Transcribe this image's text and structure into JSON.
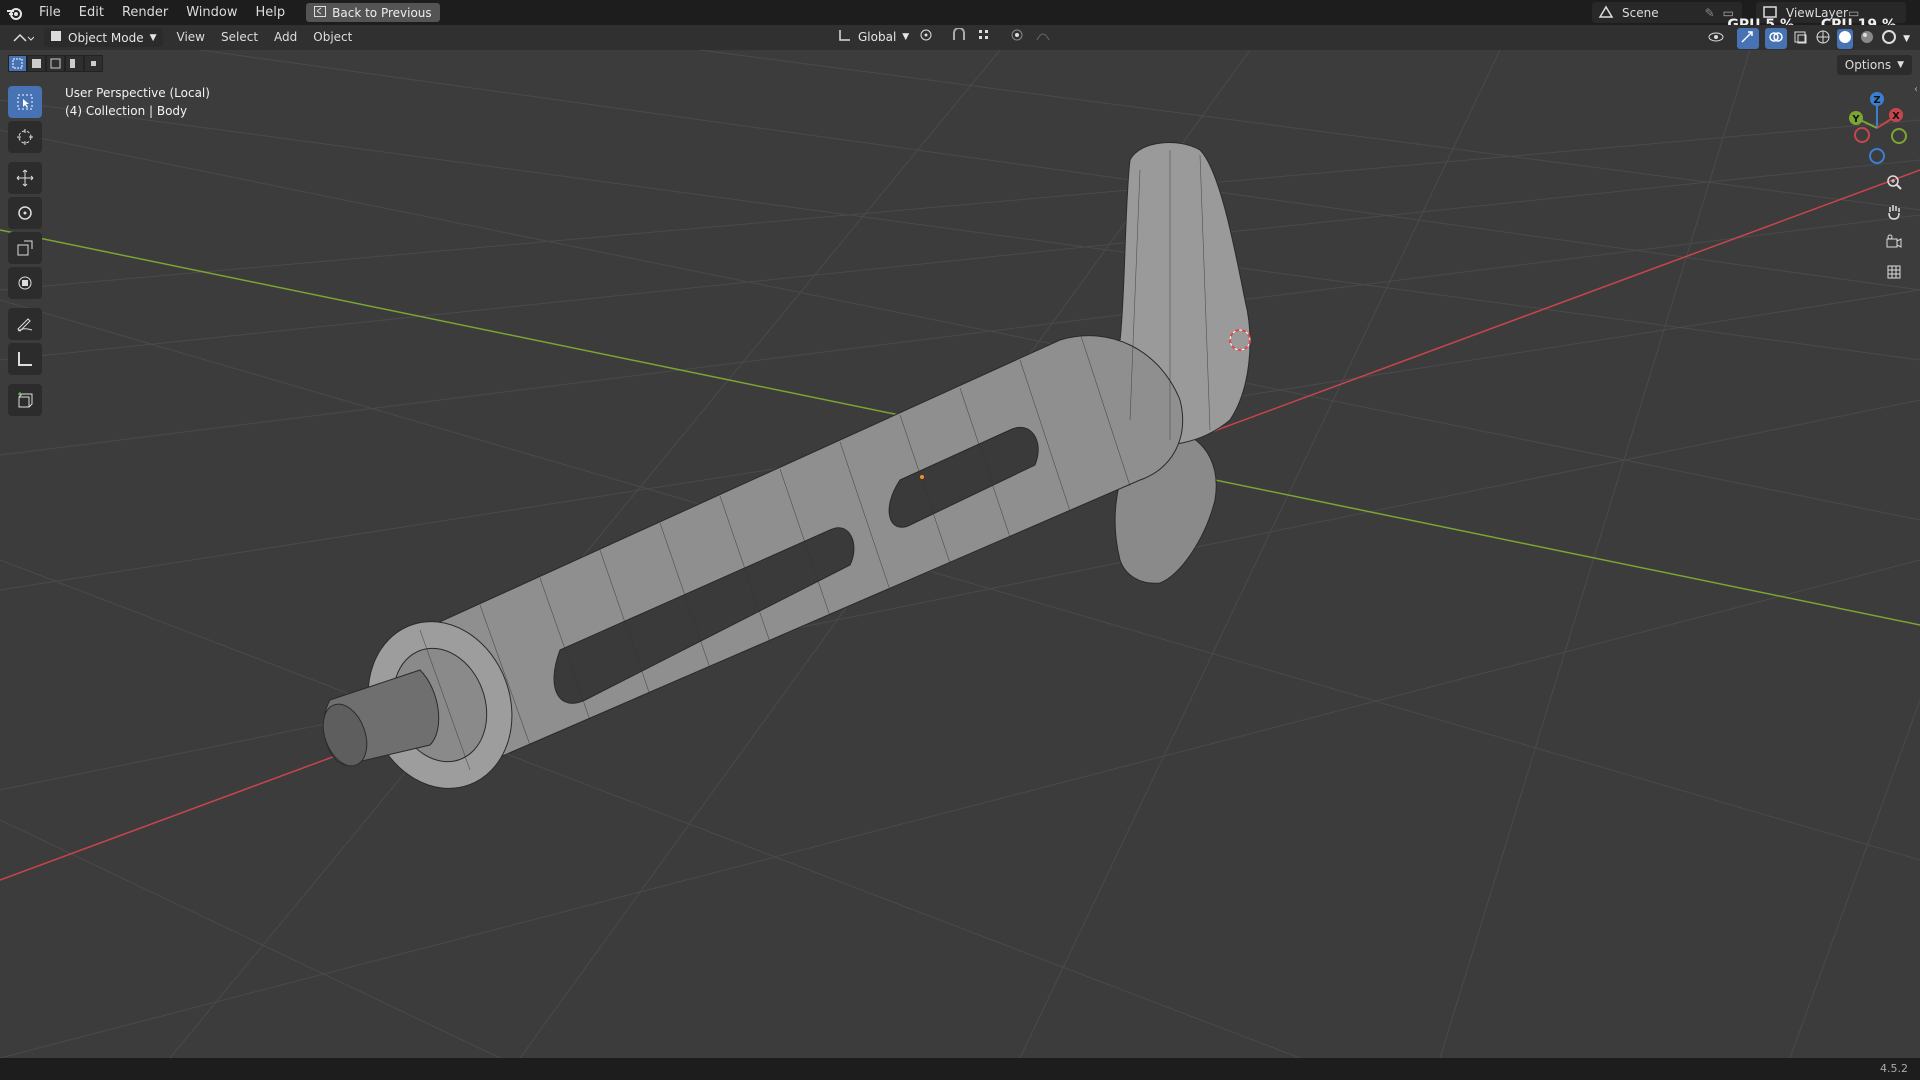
{
  "menubar": {
    "items": [
      "File",
      "Edit",
      "Render",
      "Window",
      "Help"
    ],
    "back_button": "Back to Previous",
    "scene": "Scene",
    "view_layer": "ViewLayer",
    "gpu_label": "GPU",
    "gpu_value": "5 %",
    "cpu_label": "CPU",
    "cpu_value": "19 %"
  },
  "header": {
    "mode": "Object Mode",
    "menus": [
      "View",
      "Select",
      "Add",
      "Object"
    ],
    "orientation": "Global",
    "options": "Options"
  },
  "viewport": {
    "perspective": "User Perspective (Local)",
    "collection": "(4) Collection | Body",
    "gizmo": {
      "x": "X",
      "y": "Y",
      "z": "Z"
    },
    "colors": {
      "x_axis": "#c8454e",
      "y_axis": "#7aa634",
      "z_axis": "#3b7fd4",
      "active": "#4772b3",
      "background": "#3c3c3c"
    }
  },
  "status": {
    "version": "4.5.2"
  }
}
